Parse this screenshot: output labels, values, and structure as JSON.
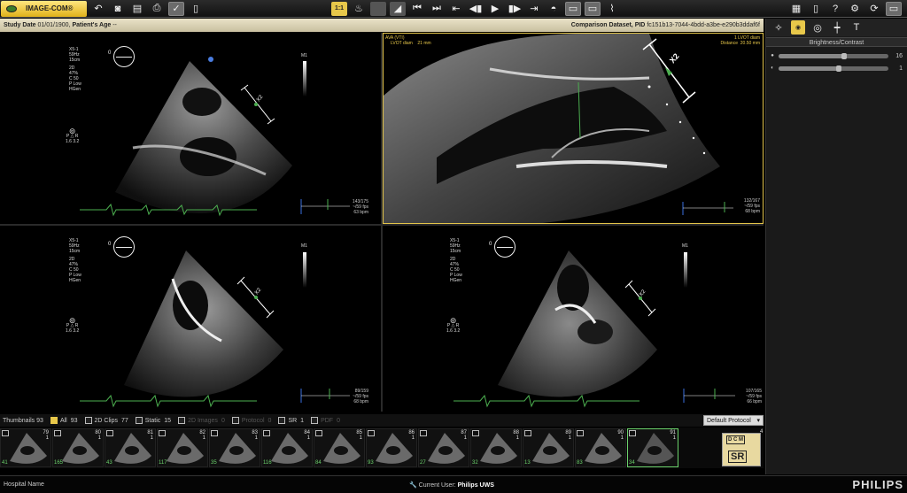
{
  "app": {
    "logo_label": "IMAGE-COM®",
    "brand": "PHILIPS"
  },
  "toolbar": {
    "icons": [
      "undo-icon",
      "camera-icon",
      "report-icon",
      "print-icon",
      "check-icon",
      "export-icon"
    ],
    "zoom_label": "1:1",
    "playback": [
      "first-frame-icon",
      "last-frame-icon",
      "prev-icon",
      "step-back-icon",
      "play-icon",
      "step-forward-icon",
      "next-icon",
      "loop-icon"
    ]
  },
  "infobar": {
    "study_date_label": "Study Date",
    "study_date": "01/01/1900,",
    "patient_age_label": "Patient's Age",
    "patient_age": "--",
    "comparison_label": "Comparison Dataset, PID",
    "pid": "fc151b13-7044-4bdd-a3be-e290b3ddaf6f"
  },
  "right_panel": {
    "title": "Brightness/Contrast",
    "brightness": {
      "value": "16",
      "level": 0.6
    },
    "contrast": {
      "value": "1",
      "level": 0.55
    }
  },
  "viewports": [
    {
      "id": "tl",
      "meta": [
        "X5-1",
        "59Hz",
        "15cm",
        "",
        "2D",
        "47%",
        "C 50",
        "P Low",
        "HGen"
      ],
      "m1": "M1",
      "zero": "0",
      "pr": [
        "P",
        "R"
      ],
      "vals": [
        "1.6",
        "3.2"
      ],
      "fps": [
        "143/175",
        "~/59 fps",
        "63 bpm"
      ],
      "bpm": "63 bpm"
    },
    {
      "id": "tr",
      "meas_title": "AVA (VTI)",
      "meas_line": "LVOT diam",
      "meas_val": "21 mm",
      "meas_right": [
        "1 LVOT diam",
        "Distance"
      ],
      "meas_right_val": "20.50 mm",
      "fps": [
        "132/167",
        "~/59 fps",
        "68 bpm"
      ],
      "x2": "X2"
    },
    {
      "id": "bl",
      "meta": [
        "X5-1",
        "59Hz",
        "15cm",
        "",
        "2D",
        "47%",
        "C 50",
        "P Low",
        "HGen"
      ],
      "m1": "M1",
      "zero": "0",
      "pr": [
        "P",
        "R"
      ],
      "vals": [
        "1.6",
        "3.2"
      ],
      "fps": [
        "89/159",
        "~/59 fps",
        "68 bpm"
      ]
    },
    {
      "id": "br",
      "meta": [
        "X5-1",
        "59Hz",
        "15cm",
        "",
        "2D",
        "47%",
        "C 50",
        "P Low",
        "HGen"
      ],
      "m1": "M1",
      "zero": "0",
      "pr": [
        "P",
        "R"
      ],
      "vals": [
        "1.6",
        "3.2"
      ],
      "fps": [
        "107/165",
        "~/59 fps",
        "66 bpm"
      ]
    }
  ],
  "thumbnails": {
    "label": "Thumbnails",
    "count": "93",
    "filters": [
      {
        "label": "All",
        "count": "93",
        "checked": true,
        "dim": false
      },
      {
        "label": "2D Clips",
        "count": "77",
        "checked": false,
        "dim": false
      },
      {
        "label": "Static",
        "count": "15",
        "checked": false,
        "dim": false
      },
      {
        "label": "2D Images",
        "count": "0",
        "checked": false,
        "dim": true
      },
      {
        "label": "Protocol",
        "count": "0",
        "checked": false,
        "dim": true
      },
      {
        "label": "SR",
        "count": "1",
        "checked": false,
        "dim": false
      },
      {
        "label": "PDF",
        "count": "0",
        "checked": false,
        "dim": true
      }
    ],
    "protocol": "Default Protocol",
    "items": [
      {
        "num": "79",
        "sub": "1",
        "g": "41"
      },
      {
        "num": "80",
        "sub": "1",
        "g": "165"
      },
      {
        "num": "81",
        "sub": "1",
        "g": "43"
      },
      {
        "num": "82",
        "sub": "1",
        "g": "117"
      },
      {
        "num": "83",
        "sub": "1",
        "g": "35"
      },
      {
        "num": "84",
        "sub": "1",
        "g": "116"
      },
      {
        "num": "85",
        "sub": "1",
        "g": "84"
      },
      {
        "num": "86",
        "sub": "1",
        "g": "93"
      },
      {
        "num": "87",
        "sub": "1",
        "g": "27"
      },
      {
        "num": "88",
        "sub": "1",
        "g": "32"
      },
      {
        "num": "89",
        "sub": "1",
        "g": "13"
      },
      {
        "num": "90",
        "sub": "1",
        "g": "83"
      },
      {
        "num": "91",
        "sub": "1",
        "g": "34"
      },
      {
        "num": "",
        "sub": "",
        "g": ""
      }
    ],
    "last_num": "4",
    "sr_card": {
      "dcm": "D C M",
      "sr": "SR"
    }
  },
  "status": {
    "hospital": "Hospital Name",
    "user_label": "Current User:",
    "user": "Philips UWS"
  },
  "colors": {
    "accent": "#e8c84a",
    "ecg": "#4caf50",
    "selected": "#6cd36c"
  }
}
